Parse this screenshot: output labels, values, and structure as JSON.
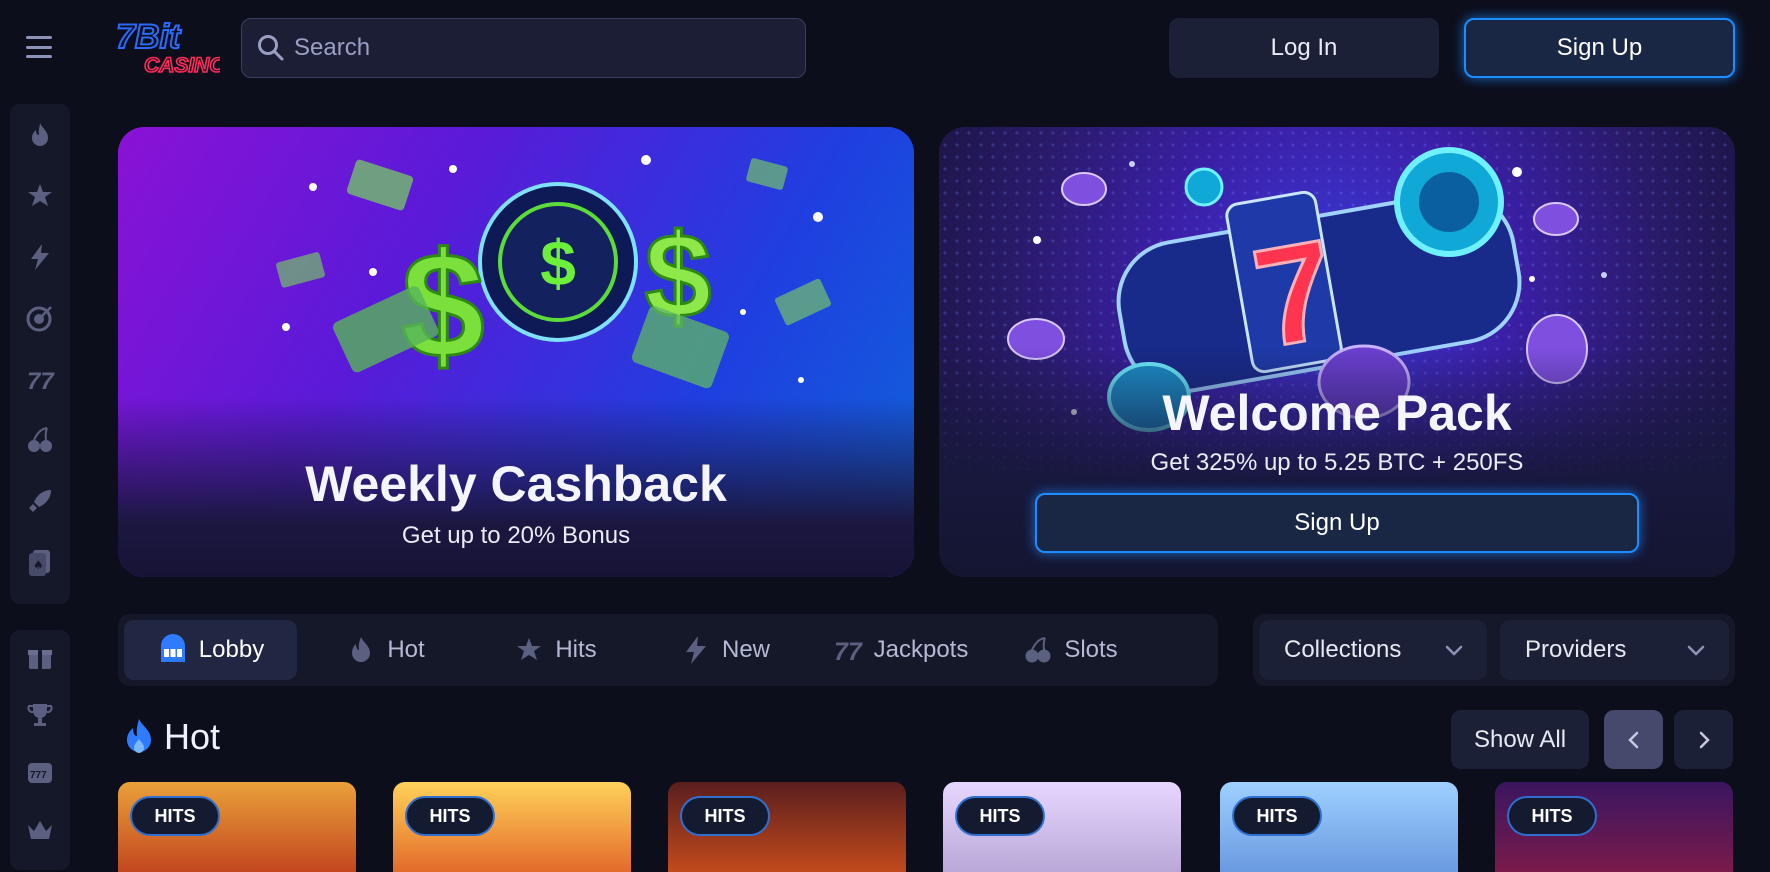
{
  "header": {
    "search_placeholder": "Search",
    "login_label": "Log In",
    "signup_label": "Sign Up"
  },
  "logo": {
    "text_top": "7Bit",
    "text_bottom": "CASINO"
  },
  "sidebar": {
    "group1": [
      "fire-icon",
      "stars-icon",
      "lightning-icon",
      "target-icon",
      "jackpot-icon",
      "cherry-icon",
      "rocket-icon",
      "cards-icon"
    ],
    "group2": [
      "gift-icon",
      "trophy-icon",
      "slot-machine-icon",
      "crown-icon"
    ]
  },
  "banners": [
    {
      "title": "Weekly Cashback",
      "subtitle": "Get up to 20% Bonus"
    },
    {
      "title": "Welcome Pack",
      "subtitle": "Get 325% up to 5.25 BTC + 250FS",
      "button": "Sign Up"
    }
  ],
  "categories": [
    {
      "label": "Lobby",
      "icon": "slot-machine-icon",
      "active": true
    },
    {
      "label": "Hot",
      "icon": "fire-icon",
      "active": false
    },
    {
      "label": "Hits",
      "icon": "stars-icon",
      "active": false
    },
    {
      "label": "New",
      "icon": "lightning-icon",
      "active": false
    },
    {
      "label": "Jackpots",
      "icon": "jackpot-icon",
      "active": false
    },
    {
      "label": "Slots",
      "icon": "cherry-icon",
      "active": false
    }
  ],
  "dropdowns": {
    "collections": "Collections",
    "providers": "Providers"
  },
  "hot_section": {
    "title": "Hot",
    "show_all": "Show All",
    "games": [
      {
        "badge": "HITS"
      },
      {
        "badge": "HITS"
      },
      {
        "badge": "HITS"
      },
      {
        "badge": "HITS"
      },
      {
        "badge": "HITS"
      },
      {
        "badge": "HITS"
      }
    ]
  },
  "colors": {
    "background": "#0c0e1b",
    "panel": "#151829",
    "accent_blue": "#1d8cff",
    "button_dark": "#1c2036"
  }
}
